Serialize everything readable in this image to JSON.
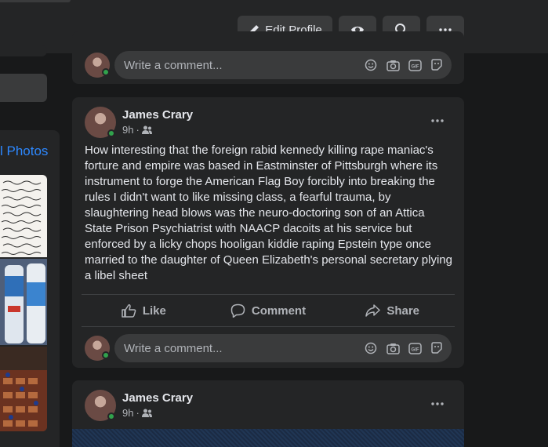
{
  "action_bar": {
    "edit_profile_label": "Edit Profile"
  },
  "sidebar": {
    "photos_link": "l Photos"
  },
  "composer": {
    "comment_placeholder": "Write a comment..."
  },
  "posts": [
    {
      "author": "James Crary",
      "time": "9h",
      "separator": "·",
      "text": "How interesting that the foreign rabid kennedy killing rape maniac's forture and empire was based in Eastminster of Pittsburgh where its instrument to forge the American Flag Boy forcibly into breaking the rules I didn't want to like missing class, a fearful trauma, by slaughtering head blows was the neuro-doctoring son of an Attica State Prison Psychiatrist with NAACP dacoits at his service but enforced by a licky chops hooligan kiddie raping Epstein type once married to the daughter of Queen Elizabeth's personal secretary plying a libel sheet",
      "actions": {
        "like": "Like",
        "comment": "Comment",
        "share": "Share"
      }
    },
    {
      "author": "James Crary",
      "time": "9h",
      "separator": "·"
    }
  ],
  "colors": {
    "background": "#18191a",
    "card": "#242526",
    "input": "#3a3b3c",
    "primary_text": "#e4e6eb",
    "secondary_text": "#b0b3b8",
    "link": "#2d88ff",
    "online": "#31a24c"
  },
  "icons": [
    "pencil-icon",
    "eye-icon",
    "search-icon",
    "more-icon",
    "emoji-icon",
    "camera-icon",
    "gif-icon",
    "sticker-icon",
    "friends-icon",
    "like-icon",
    "comment-icon",
    "share-icon"
  ]
}
